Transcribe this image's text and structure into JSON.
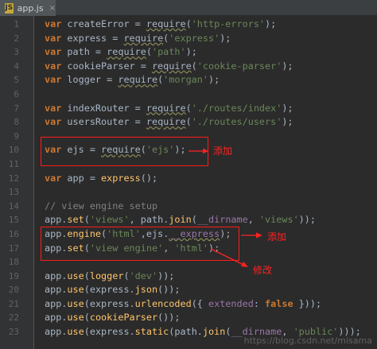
{
  "tab": {
    "icon_letter": "JS",
    "label": "app.js",
    "close": "×"
  },
  "line_numbers": [
    "1",
    "2",
    "3",
    "4",
    "5",
    "6",
    "7",
    "8",
    "9",
    "10",
    "11",
    "12",
    "13",
    "14",
    "15",
    "16",
    "17",
    "18",
    "19",
    "20",
    "21",
    "22",
    "23"
  ],
  "code": {
    "l1": {
      "kw": "var",
      "a": " createError = ",
      "fn": "require",
      "b": "(",
      "s": "'http-errors'",
      "c": ");"
    },
    "l2": {
      "kw": "var",
      "a": " express = ",
      "fn": "require",
      "b": "(",
      "s": "'express'",
      "c": ");"
    },
    "l3": {
      "kw": "var",
      "a": " path = ",
      "fn": "require",
      "b": "(",
      "s": "'path'",
      "c": ");"
    },
    "l4": {
      "kw": "var",
      "a": " cookieParser = ",
      "fn": "require",
      "b": "(",
      "s": "'cookie-parser'",
      "c": ");"
    },
    "l5": {
      "kw": "var",
      "a": " logger = ",
      "fn": "require",
      "b": "(",
      "s": "'morgan'",
      "c": ");"
    },
    "l7": {
      "kw": "var",
      "a": " indexRouter = ",
      "fn": "require",
      "b": "(",
      "s": "'./routes/index'",
      "c": ");"
    },
    "l8": {
      "kw": "var",
      "a": " usersRouter = ",
      "fn": "require",
      "b": "(",
      "s": "'./routes/users'",
      "c": ");"
    },
    "l10": {
      "kw": "var",
      "a": " ejs = ",
      "fn": "require",
      "b": "(",
      "s": "'ejs'",
      "c": ");"
    },
    "l12": {
      "kw": "var",
      "a": " app = ",
      "fn": "express",
      "c": "();"
    },
    "l14": {
      "com": "// view engine setup"
    },
    "l15": {
      "a": "app.",
      "fn": "set",
      "b": "(",
      "s": "'views'",
      "c": ", path.",
      "fn2": "join",
      "d": "(",
      "dn": "__dirname",
      "e": ", ",
      "s2": "'views'",
      "f": "));"
    },
    "l16": {
      "a": "app.",
      "fn": "engine",
      "b": "(",
      "s": "'html'",
      "c": ",ejs.",
      "p": "__express",
      "d": ");"
    },
    "l17": {
      "a": "app.",
      "fn": "set",
      "b": "(",
      "s": "'view engine'",
      "c": ", ",
      "s2": "'html'",
      "d": ");"
    },
    "l19": {
      "a": "app.",
      "fn": "use",
      "b": "(",
      "fn2": "logger",
      "c": "(",
      "s": "'dev'",
      "d": "));"
    },
    "l20": {
      "a": "app.",
      "fn": "use",
      "b": "(express.",
      "fn2": "json",
      "c": "());"
    },
    "l21": {
      "a": "app.",
      "fn": "use",
      "b": "(express.",
      "fn2": "urlencoded",
      "c": "({ ",
      "p": "extended",
      "d": ": ",
      "kw": "false",
      "e": " }));"
    },
    "l22": {
      "a": "app.",
      "fn": "use",
      "b": "(",
      "fn2": "cookieParser",
      "c": "());"
    },
    "l23": {
      "a": "app.",
      "fn": "use",
      "b": "(express.",
      "fn2": "static",
      "c": "(path.",
      "fn3": "join",
      "d": "(",
      "dn": "__dirname",
      "e": ", ",
      "s": "'public'",
      "f": ")));"
    }
  },
  "annotations": {
    "add1": "添加",
    "add2": "添加",
    "modify": "修改"
  },
  "watermark": "https://blog.csdn.net/misama",
  "colors": {
    "annotation": "#ff2222",
    "keyword": "#cc7832",
    "string": "#6a8759",
    "function": "#ffc66d"
  }
}
